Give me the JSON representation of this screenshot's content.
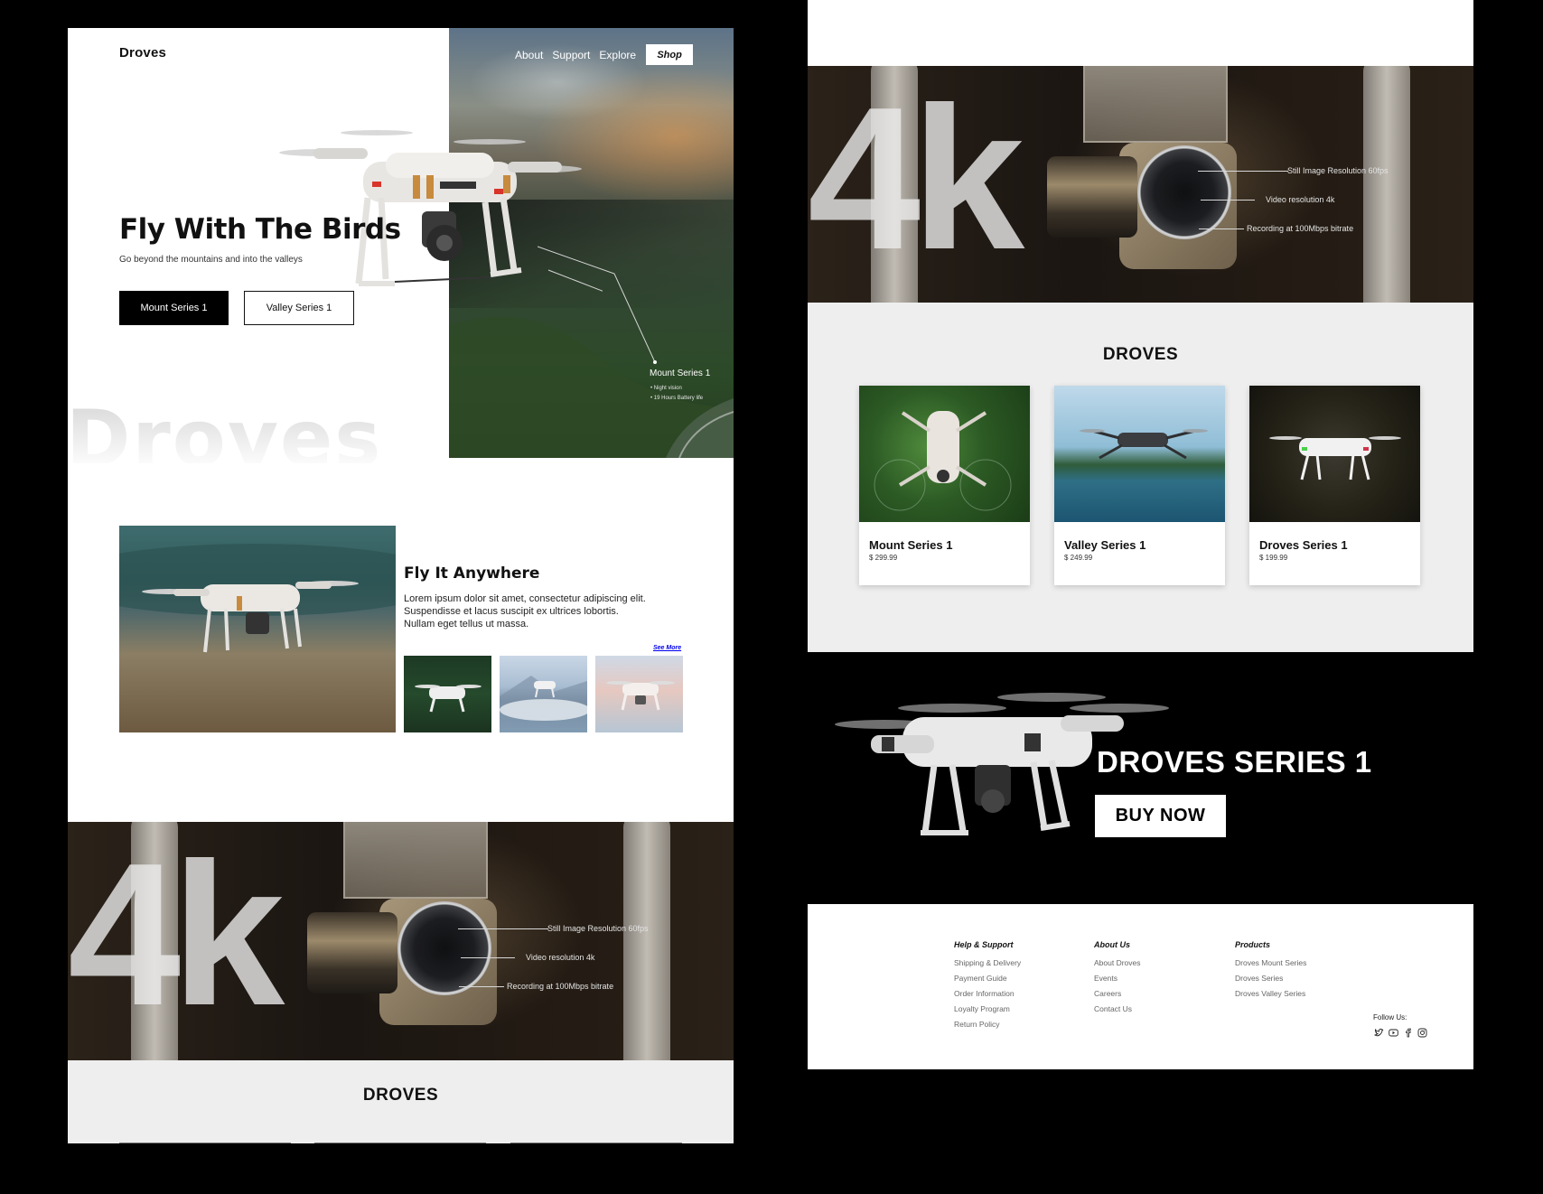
{
  "header": {
    "brand": "Droves",
    "nav": [
      "About",
      "Support",
      "Explore"
    ],
    "shop_label": "Shop"
  },
  "hero": {
    "title": "Fly With The Birds",
    "subtitle": "Go beyond the mountains and into the valleys",
    "primary_button": "Mount Series 1",
    "secondary_button": "Valley Series 1",
    "watermark": "Droves",
    "callout": {
      "title": "Mount Series 1",
      "features": [
        "Night vision",
        "19 Hours Battery life"
      ]
    }
  },
  "fly_section": {
    "title": "Fly It Anywhere",
    "body": "Lorem ipsum dolor sit amet, consectetur adipiscing elit. Suspendisse et lacus suscipit ex ultrices lobortis. Nullam eget tellus ut massa.",
    "see_more": "See More"
  },
  "k4": {
    "big_text": "4k",
    "specs": [
      "Still Image Resolution 60fps",
      "Video resolution 4k",
      "Recording at 100Mbps bitrate"
    ]
  },
  "products": {
    "title": "DROVES",
    "items": [
      {
        "name": "Mount Series 1",
        "price": "$ 299.99"
      },
      {
        "name": "Valley Series 1",
        "price": "$ 249.99"
      },
      {
        "name": "Droves Series 1",
        "price": "$ 199.99"
      }
    ]
  },
  "promo": {
    "title": "DROVES SERIES 1",
    "button": "BUY NOW"
  },
  "footer": {
    "columns": [
      {
        "title": "Help & Support",
        "links": [
          "Shipping & Delivery",
          "Payment Guide",
          "Order Information",
          "Loyalty Program",
          "Return Policy"
        ]
      },
      {
        "title": "About Us",
        "links": [
          "About Droves",
          "Events",
          "Careers",
          "Contact Us"
        ]
      },
      {
        "title": "Products",
        "links": [
          "Droves Mount Series",
          "Droves Series",
          "Droves Valley Series"
        ]
      }
    ],
    "follow_label": "Follow Us:",
    "social_icons": [
      "twitter-icon",
      "youtube-icon",
      "facebook-icon",
      "instagram-icon"
    ]
  }
}
